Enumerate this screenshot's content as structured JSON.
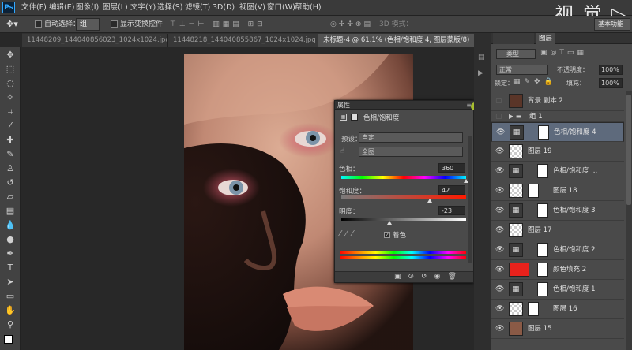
{
  "app": {
    "logo": "Ps",
    "watermark": "视 觉 ▷"
  },
  "menu": [
    "文件(F)",
    "编辑(E)",
    "图像(I)",
    "图层(L)",
    "文字(Y)",
    "选择(S)",
    "滤镜(T)",
    "3D(D)",
    "视图(V)",
    "窗口(W)",
    "帮助(H)"
  ],
  "options": {
    "auto_select_label": "自动选择：",
    "auto_select_value": "组",
    "show_transform_label": "显示变换控件",
    "mode_3d_label": "3D 模式：",
    "workspace": "基本功能"
  },
  "tabs": [
    {
      "label": "11448209_144040856023_1024x1024.jpg",
      "active": false
    },
    {
      "label": "11448218_144040855867_1024x1024.jpg",
      "active": false
    },
    {
      "label": "未标题-4 @ 61.1% (色相/饱和度 4, 图层蒙版/8)",
      "active": true
    }
  ],
  "properties": {
    "title": "属性",
    "adjust_name": "色相/饱和度",
    "preset_label": "预设：",
    "preset_value": "自定",
    "channel_value": "全图",
    "hue_label": "色相：",
    "hue_value": "360",
    "hue_level": 1.0,
    "sat_label": "饱和度：",
    "sat_value": "42",
    "sat_level": 0.71,
    "light_label": "明度：",
    "light_value": "-23",
    "light_level": 0.385,
    "colorize_label": "着色",
    "colorize_checked": true
  },
  "layers_panel": {
    "tabs": [
      "图层"
    ],
    "kind_label": "类型",
    "blend_mode": "正常",
    "opacity_label": "不透明度：",
    "opacity_value": "100%",
    "lock_label": "锁定：",
    "fill_label": "填充：",
    "fill_value": "100%",
    "layers": [
      {
        "name": "背景 副本 2",
        "type": "photo",
        "visible": false,
        "selected": false
      },
      {
        "name": "组 1",
        "type": "group",
        "visible": false,
        "selected": false
      },
      {
        "name": "色相/饱和度 4",
        "type": "adjust",
        "visible": true,
        "selected": true
      },
      {
        "name": "图层 19",
        "type": "pixel",
        "visible": true,
        "selected": false
      },
      {
        "name": "色相/饱和度 ...",
        "type": "adjust",
        "visible": true,
        "selected": false
      },
      {
        "name": "图层 18",
        "type": "pixel-mask",
        "visible": true,
        "selected": false
      },
      {
        "name": "色相/饱和度 3",
        "type": "adjust",
        "visible": true,
        "selected": false
      },
      {
        "name": "图层 17",
        "type": "pixel",
        "visible": true,
        "selected": false
      },
      {
        "name": "色相/饱和度 2",
        "type": "adjust",
        "visible": true,
        "selected": false
      },
      {
        "name": "颜色填充 2",
        "type": "fill",
        "visible": true,
        "selected": false
      },
      {
        "name": "色相/饱和度 1",
        "type": "adjust",
        "visible": true,
        "selected": false
      },
      {
        "name": "图层 16",
        "type": "pixel-mask",
        "visible": true,
        "selected": false
      },
      {
        "name": "图层 15",
        "type": "photo",
        "visible": true,
        "selected": false
      }
    ]
  },
  "colors": {
    "fill_swatch": "#e8221c",
    "selected_layer": "#5e6a7c"
  }
}
